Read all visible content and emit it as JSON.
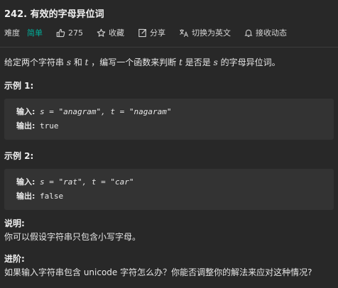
{
  "problem": {
    "title": "242. 有效的字母异位词"
  },
  "meta": {
    "difficulty_label": "难度",
    "difficulty_value": "简单",
    "likes": "275",
    "favorite_label": "收藏",
    "share_label": "分享",
    "translate_label": "切换为英文",
    "notify_label": "接收动态"
  },
  "description": {
    "part1": "给定两个字符串 ",
    "var_s": "s",
    "part2": " 和 ",
    "var_t": "t",
    "part3": " ，编写一个函数来判断 ",
    "var_t2": "t",
    "part4": " 是否是 ",
    "var_s2": "s",
    "part5": " 的字母异位词。"
  },
  "examples": [
    {
      "heading": "示例 1:",
      "input_label": "输入:",
      "input_text": " s = \"anagram\", t = \"nagaram\"",
      "output_label": "输出:",
      "output_text": " true"
    },
    {
      "heading": "示例 2:",
      "input_label": "输入:",
      "input_text": " s = \"rat\", t = \"car\"",
      "output_label": "输出:",
      "output_text": " false"
    }
  ],
  "note": {
    "heading": "说明:",
    "text": "你可以假设字符串只包含小写字母。"
  },
  "advanced": {
    "heading": "进阶:",
    "text": "如果输入字符串包含 unicode 字符怎么办？你能否调整你的解法来应对这种情况?"
  },
  "colors": {
    "background": "#282828",
    "difficulty_easy": "#00af9b",
    "code_background": "#333333"
  }
}
